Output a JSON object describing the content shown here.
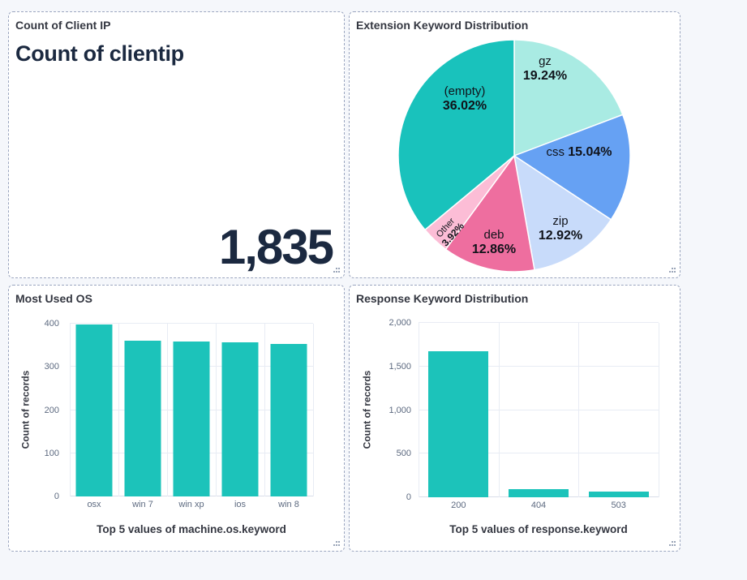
{
  "panels": {
    "client_ip": {
      "title": "Count of Client IP",
      "metric_label": "Count of clientip",
      "metric_value": "1,835"
    },
    "extension": {
      "title": "Extension Keyword Distribution"
    },
    "os": {
      "title": "Most Used OS"
    },
    "response": {
      "title": "Response Keyword Distribution"
    }
  },
  "colors": {
    "accent_teal": "#1CC3BA",
    "page_background": "#f5f7fb",
    "panel_border": "#9aa5bf",
    "grid_line": "#e8ecf4",
    "axis_text": "#5d6a80",
    "title_text": "#343741",
    "metric_text": "#1b2940"
  },
  "chart_data": [
    {
      "id": "extension-pie",
      "type": "pie",
      "title": "Extension Keyword Distribution",
      "start_angle": "top",
      "direction": "clockwise",
      "slices": [
        {
          "label": "gz",
          "value": 19.24,
          "pct_label": "19.24%",
          "color": "#A9EBE3"
        },
        {
          "label": "css",
          "value": 15.04,
          "pct_label": "15.04%",
          "color": "#66A1F3",
          "inline": true
        },
        {
          "label": "zip",
          "value": 12.92,
          "pct_label": "12.92%",
          "color": "#C8DBFA"
        },
        {
          "label": "deb",
          "value": 12.86,
          "pct_label": "12.86%",
          "color": "#EE6E9F"
        },
        {
          "label": "Other",
          "value": 3.92,
          "pct_label": "3.92%",
          "color": "#FCBDD6",
          "rotate": -48
        },
        {
          "label": "(empty)",
          "value": 36.02,
          "pct_label": "36.02%",
          "color": "#19C2BC"
        }
      ]
    },
    {
      "id": "os-bar",
      "type": "bar",
      "categories": [
        "osx",
        "win 7",
        "win xp",
        "ios",
        "win 8"
      ],
      "values": [
        399,
        361,
        359,
        357,
        354
      ],
      "ylabel": "Count of records",
      "xlabel": "Top 5 values of machine.os.keyword",
      "ylim": [
        0,
        400
      ],
      "yticks": [
        0,
        100,
        200,
        300,
        400
      ],
      "ytick_labels": [
        "0",
        "100",
        "200",
        "300",
        "400"
      ],
      "bar_color": "#1CC3BA",
      "grid": true,
      "legend": "none"
    },
    {
      "id": "response-bar",
      "type": "bar",
      "categories": [
        "200",
        "404",
        "503"
      ],
      "values": [
        1675,
        95,
        65
      ],
      "ylabel": "Count of records",
      "xlabel": "Top 5 values of response.keyword",
      "ylim": [
        0,
        2000
      ],
      "yticks": [
        0,
        500,
        1000,
        1500,
        2000
      ],
      "ytick_labels": [
        "0",
        "500",
        "1,000",
        "1,500",
        "2,000"
      ],
      "bar_color": "#1CC3BA",
      "grid": true,
      "legend": "none"
    }
  ]
}
